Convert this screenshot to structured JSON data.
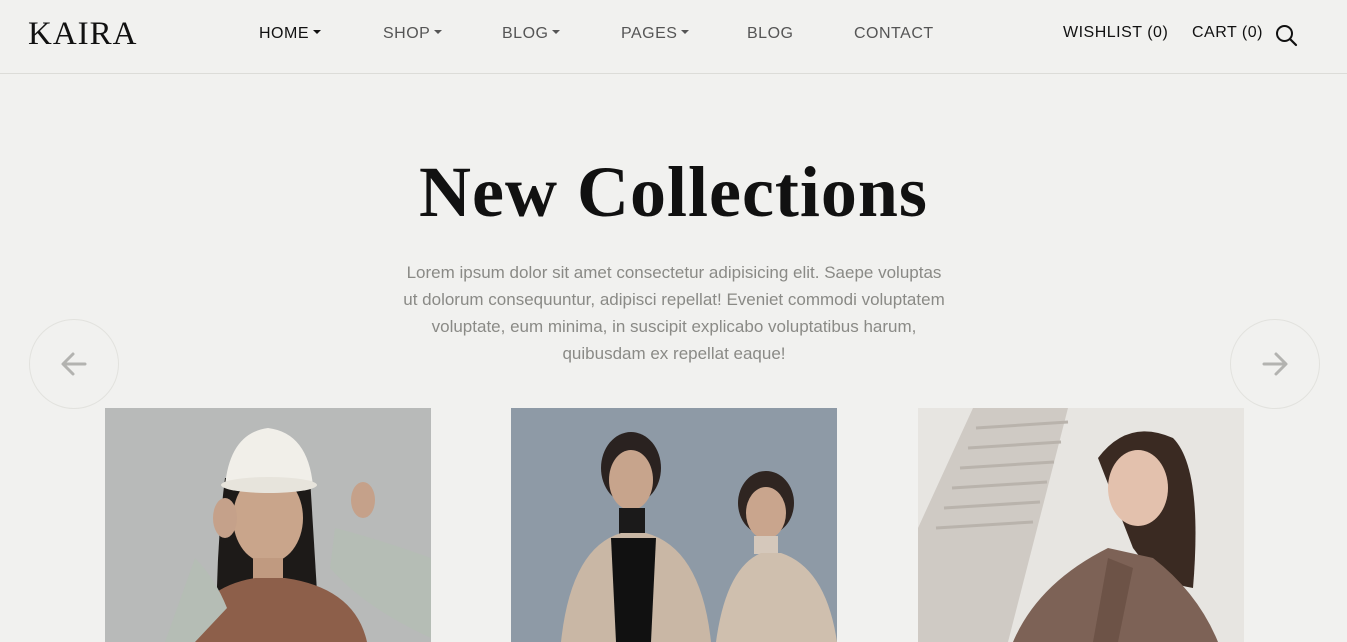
{
  "brand": {
    "logo": "KAIRA"
  },
  "nav": {
    "items": [
      {
        "label": "HOME",
        "has_dropdown": true,
        "active": true
      },
      {
        "label": "SHOP",
        "has_dropdown": true,
        "active": false
      },
      {
        "label": "BLOG",
        "has_dropdown": true,
        "active": false
      },
      {
        "label": "PAGES",
        "has_dropdown": true,
        "active": false
      },
      {
        "label": "BLOG",
        "has_dropdown": false,
        "active": false
      },
      {
        "label": "CONTACT",
        "has_dropdown": false,
        "active": false
      }
    ]
  },
  "header_actions": {
    "wishlist": "WISHLIST (0)",
    "cart": "CART (0)",
    "search_icon": "search-icon"
  },
  "hero": {
    "title": "New Collections",
    "description": "Lorem ipsum dolor sit amet consectetur adipisicing elit. Saepe voluptas ut dolorum consequuntur, adipisci repellat! Eveniet commodi voluptatem voluptate, eum minima, in suscipit explicabo voluptatibus harum, quibusdam ex repellat eaque!"
  },
  "carousel": {
    "prev_icon": "arrow-left-icon",
    "next_icon": "arrow-right-icon"
  },
  "colors": {
    "background": "#f1f1ef",
    "text_dark": "#111111",
    "text_muted": "#8a8a86",
    "nav_text": "#555555"
  }
}
